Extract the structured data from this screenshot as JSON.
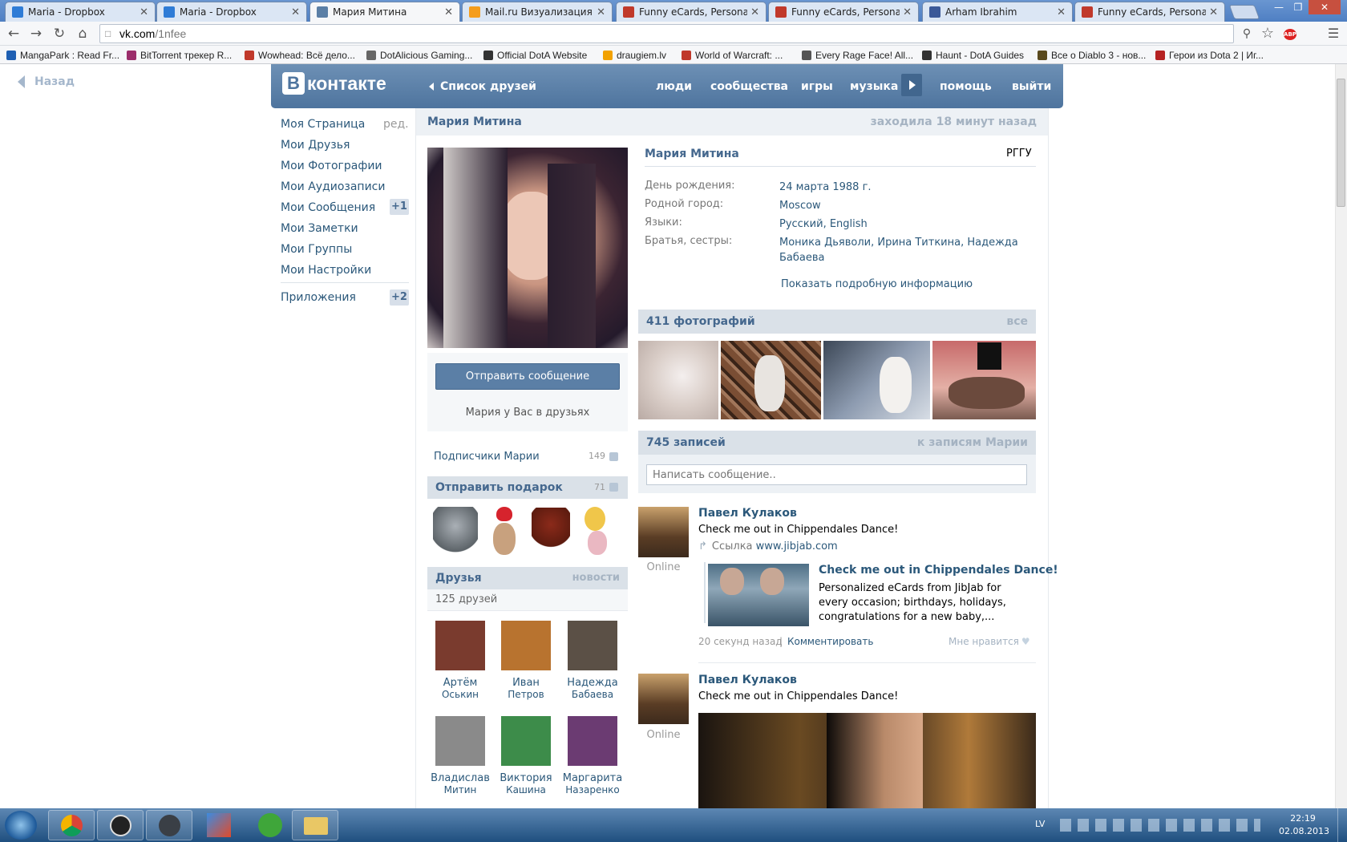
{
  "browser": {
    "tabs": [
      {
        "label": "Maria - Dropbox",
        "icon": "dropbox-icon",
        "active": false
      },
      {
        "label": "Maria - Dropbox",
        "icon": "dropbox-icon",
        "active": false
      },
      {
        "label": "Мария Митина",
        "icon": "vk-icon",
        "active": true
      },
      {
        "label": "Mail.ru Визуализация закла",
        "icon": "mailru-icon",
        "active": false
      },
      {
        "label": "Funny eCards, Personalize",
        "icon": "jibjab-icon",
        "active": false
      },
      {
        "label": "Funny eCards, Personalize",
        "icon": "jibjab-icon",
        "active": false
      },
      {
        "label": "Arham Ibrahim",
        "icon": "facebook-icon",
        "active": false
      },
      {
        "label": "Funny eCards, Personalize",
        "icon": "jibjab-icon",
        "active": false
      }
    ],
    "url_host": "vk.com",
    "url_path": "/1nfee",
    "bookmarks": [
      {
        "label": "MangaPark : Read Fr...",
        "color": "#1e5fb3"
      },
      {
        "label": "BitTorrent трекер R...",
        "color": "#9b2d6b"
      },
      {
        "label": "Wowhead: Всё дело...",
        "color": "#c0392b"
      },
      {
        "label": "DotAlicious Gaming...",
        "color": "#666666"
      },
      {
        "label": "Official DotA Website",
        "color": "#333333"
      },
      {
        "label": "draugiem.lv",
        "color": "#f2a100"
      },
      {
        "label": "World of Warcraft: ...",
        "color": "#c0392b"
      },
      {
        "label": "Every Rage Face! All...",
        "color": "#555555"
      },
      {
        "label": "Haunt - DotA Guides",
        "color": "#333333"
      },
      {
        "label": "Все о Diablo 3 - нов...",
        "color": "#5a4a1e"
      },
      {
        "label": "Герои из Dota 2 | Иг...",
        "color": "#b52222"
      }
    ]
  },
  "back_link": "Назад",
  "header": {
    "logo_letter": "В",
    "logo_text": "контакте",
    "friends_link": "Список друзей",
    "nav": [
      "люди",
      "сообщества",
      "игры",
      "музыка",
      "помощь",
      "выйти"
    ]
  },
  "left_menu": {
    "items": [
      "Моя Страница",
      "Мои Друзья",
      "Мои Фотографии",
      "Мои Аудиозаписи",
      "Мои Сообщения",
      "Мои Заметки",
      "Мои Группы",
      "Мои Настройки"
    ],
    "edit_label": "ред.",
    "messages_badge": "+1",
    "apps_label": "Приложения",
    "apps_badge": "+2"
  },
  "profile": {
    "name": "Мария Митина",
    "last_seen": "заходила 18 минут назад",
    "university": "РГГУ",
    "info": [
      {
        "label": "День рождения:",
        "value": "24 марта 1988 г."
      },
      {
        "label": "Родной город:",
        "value": "Moscow"
      },
      {
        "label": "Языки:",
        "value": "Русский, English"
      },
      {
        "label": "Братья, сестры:",
        "value": "Моника Дьяволи, Ирина Титкина, Надежда Бабаева"
      }
    ],
    "show_more": "Показать подробную информацию",
    "send_message": "Отправить сообщение",
    "friend_status": "Мария у Вас в друзьях",
    "followers_label": "Подписчики Марии",
    "followers_count": "149",
    "gift_label": "Отправить подарок",
    "gift_count": "71",
    "friends_title": "Друзья",
    "friends_news": "новости",
    "friends_count": "125 друзей",
    "friends": [
      {
        "first": "Артём",
        "last": "Оськин",
        "color": "#7a3b2e"
      },
      {
        "first": "Иван",
        "last": "Петров",
        "color": "#b8732f"
      },
      {
        "first": "Надежда",
        "last": "Бабаева",
        "color": "#5b5046"
      },
      {
        "first": "Владислав",
        "last": "Митин",
        "color": "#8a8a8a"
      },
      {
        "first": "Виктория",
        "last": "Кашина",
        "color": "#3d8c4a"
      },
      {
        "first": "Маргарита",
        "last": "Назаренко",
        "color": "#6b3b72"
      }
    ]
  },
  "photos": {
    "title": "411 фотографий",
    "all": "все"
  },
  "wall": {
    "title": "745 записей",
    "link": "к записям Марии",
    "placeholder": "Написать сообщение..",
    "posts": [
      {
        "author": "Павел Кулаков",
        "status": "Online",
        "text": "Check me out in Chippendales Dance!",
        "link_label": "Ссылка",
        "link_url": "www.jibjab.com",
        "card_title": "Check me out in Chippendales Dance!",
        "card_text": "Personalized eCards from JibJab for every occasion; birthdays, holidays, congratulations for a new baby,...",
        "time": "20 секунд назад",
        "comment": "Комментировать",
        "like": "Мне нравится"
      },
      {
        "author": "Павел Кулаков",
        "status": "Online",
        "text": "Check me out in Chippendales Dance!"
      }
    ]
  },
  "taskbar": {
    "lang": "LV",
    "time": "22:19",
    "date": "02.08.2013"
  }
}
